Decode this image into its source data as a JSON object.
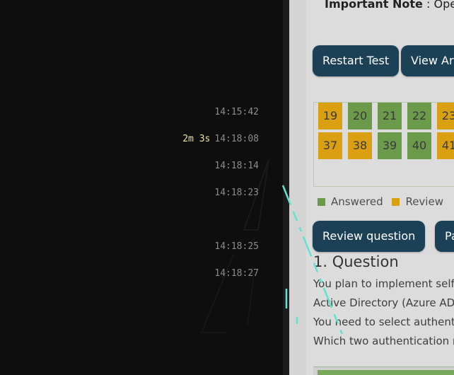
{
  "terminal": {
    "rows": [
      {
        "duration": "",
        "time": "14:15:42"
      },
      {
        "duration": "2m 3s",
        "time": "14:18:08"
      },
      {
        "duration": "",
        "time": "14:18:14"
      },
      {
        "duration": "",
        "time": "14:18:23"
      },
      {
        "duration": "",
        "time": "14:18:25"
      },
      {
        "duration": "",
        "time": "14:18:27"
      }
    ],
    "accent_color": "#5fe3d2"
  },
  "app": {
    "note_label": "Important Note",
    "note_sep": " : ",
    "note_text": "Open",
    "restart_button": "Restart Test",
    "view_button": "View Ar",
    "grid_row1": [
      {
        "n": "19",
        "status": "review"
      },
      {
        "n": "20",
        "status": "answered"
      },
      {
        "n": "21",
        "status": "answered"
      },
      {
        "n": "22",
        "status": "answered"
      },
      {
        "n": "23",
        "status": "review"
      }
    ],
    "grid_row2": [
      {
        "n": "37",
        "status": "review"
      },
      {
        "n": "38",
        "status": "review"
      },
      {
        "n": "39",
        "status": "answered"
      },
      {
        "n": "40",
        "status": "answered"
      },
      {
        "n": "41",
        "status": "review"
      }
    ],
    "legend_answered": "Answered",
    "legend_review": "Review",
    "review_button": "Review question",
    "pause_button": "Pa",
    "question_title": "1. Question",
    "question_lines": [
      "You plan to implement self",
      "Active Directory (Azure AD)",
      "You need to select authent",
      "Which two authentication m"
    ],
    "colors": {
      "button": "#1c4156",
      "answered": "#6a9a4a",
      "review": "#dba012"
    }
  }
}
